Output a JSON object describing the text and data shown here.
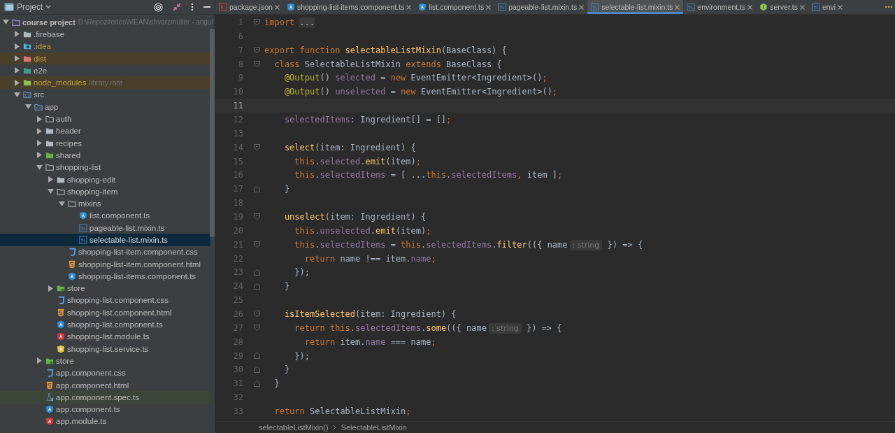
{
  "project_panel": {
    "title": "Project",
    "tree": [
      {
        "name": "course project",
        "path": "D:\\Repozitories\\MEAN\\shvarzmuller - angul",
        "kind": "root-folder",
        "expanded": true,
        "selected": false,
        "children": [
          {
            "name": ".firebase",
            "kind": "folder",
            "expanded": false,
            "selected": false,
            "ignored": false,
            "excluded": false
          },
          {
            "name": ".idea",
            "kind": "idea-folder",
            "expanded": false,
            "selected": false,
            "ignored": true,
            "excluded": false
          },
          {
            "name": "dist",
            "kind": "excluded-folder",
            "expanded": false,
            "selected": false,
            "ignored": true,
            "excluded": true
          },
          {
            "name": "e2e",
            "kind": "test-folder",
            "expanded": false,
            "selected": false,
            "ignored": false,
            "excluded": false
          },
          {
            "name": "node_modules",
            "suffix": "library root",
            "kind": "library-folder",
            "expanded": false,
            "selected": false,
            "ignored": true,
            "excluded": true
          },
          {
            "name": "src",
            "kind": "source-folder",
            "expanded": true,
            "selected": false,
            "ignored": false,
            "excluded": false,
            "children": [
              {
                "name": "app",
                "kind": "source-folder",
                "expanded": true,
                "selected": false,
                "children": [
                  {
                    "name": "auth",
                    "kind": "folder-outline",
                    "expanded": false,
                    "selected": false
                  },
                  {
                    "name": "header",
                    "kind": "folder",
                    "expanded": false,
                    "selected": false
                  },
                  {
                    "name": "recipes",
                    "kind": "folder",
                    "expanded": false,
                    "selected": false
                  },
                  {
                    "name": "shared",
                    "kind": "module-folder",
                    "expanded": false,
                    "selected": false
                  },
                  {
                    "name": "shopping-list",
                    "kind": "folder-outline",
                    "expanded": true,
                    "selected": false,
                    "children": [
                      {
                        "name": "shopping-edit",
                        "kind": "folder",
                        "expanded": false,
                        "selected": false
                      },
                      {
                        "name": "shopping-item",
                        "kind": "folder-outline",
                        "expanded": true,
                        "selected": false,
                        "children": [
                          {
                            "name": "mixins",
                            "kind": "folder-outline",
                            "expanded": true,
                            "selected": false,
                            "children": [
                              {
                                "name": "list.component.ts",
                                "kind": "angular-component",
                                "selected": false
                              },
                              {
                                "name": "pageable-list.mixin.ts",
                                "kind": "typescript",
                                "selected": false
                              },
                              {
                                "name": "selectable-list.mixin.ts",
                                "kind": "typescript",
                                "selected": true
                              }
                            ]
                          },
                          {
                            "name": "shopping-list-item.component.css",
                            "kind": "css",
                            "selected": false
                          },
                          {
                            "name": "shopping-list-item.component.html",
                            "kind": "html",
                            "selected": false
                          },
                          {
                            "name": "shopping-list-items.component.ts",
                            "kind": "angular-component",
                            "selected": false
                          }
                        ]
                      },
                      {
                        "name": "store",
                        "kind": "store-folder",
                        "expanded": false,
                        "selected": false
                      },
                      {
                        "name": "shopping-list.component.css",
                        "kind": "css",
                        "selected": false
                      },
                      {
                        "name": "shopping-list.component.html",
                        "kind": "html",
                        "selected": false
                      },
                      {
                        "name": "shopping-list.component.ts",
                        "kind": "angular-component",
                        "selected": false
                      },
                      {
                        "name": "shopping-list.module.ts",
                        "kind": "angular-module",
                        "selected": false
                      },
                      {
                        "name": "shopping-list.service.ts",
                        "kind": "angular-service",
                        "selected": false
                      }
                    ]
                  },
                  {
                    "name": "store",
                    "kind": "store-folder",
                    "expanded": false,
                    "selected": false
                  },
                  {
                    "name": "app.component.css",
                    "kind": "css",
                    "selected": false
                  },
                  {
                    "name": "app.component.html",
                    "kind": "html",
                    "selected": false
                  },
                  {
                    "name": "app.component.spec.ts",
                    "kind": "spec",
                    "selected": false
                  },
                  {
                    "name": "app.component.ts",
                    "kind": "angular-component",
                    "selected": false
                  },
                  {
                    "name": "app.module.ts",
                    "kind": "angular-module",
                    "selected": false
                  }
                ]
              }
            ]
          }
        ]
      }
    ]
  },
  "tabs": [
    {
      "label": "package.json",
      "kind": "json",
      "selected": false
    },
    {
      "label": "shopping-list-items.component.ts",
      "kind": "angular-component",
      "selected": false
    },
    {
      "label": "list.component.ts",
      "kind": "angular-component",
      "selected": false
    },
    {
      "label": "pageable-list.mixin.ts",
      "kind": "typescript",
      "selected": false
    },
    {
      "label": "selectable-list.mixin.ts",
      "kind": "typescript",
      "selected": true
    },
    {
      "label": "environment.ts",
      "kind": "typescript",
      "selected": false
    },
    {
      "label": "server.ts",
      "kind": "node",
      "selected": false
    },
    {
      "label": "envi",
      "kind": "typescript",
      "selected": false
    }
  ],
  "editor": {
    "lines": [
      {
        "number": "1",
        "kind": "fold-start",
        "current": false,
        "tokens": [
          {
            "kind": "keyword",
            "text": "import"
          },
          {
            "kind": "folded",
            "text": "..."
          }
        ]
      },
      {
        "number": "6",
        "kind": "plain",
        "current": false
      },
      {
        "number": "7",
        "kind": "fold-start",
        "current": false,
        "tokens": [
          {
            "kind": "keyword",
            "text": "export function "
          },
          {
            "kind": "function",
            "text": "selectableListMixin"
          },
          {
            "kind": "plain",
            "text": "(BaseClass) {"
          }
        ]
      },
      {
        "number": "8",
        "kind": "fold-start",
        "current": false,
        "tokens": [
          {
            "kind": "keyword",
            "text": "  class "
          },
          {
            "kind": "plain",
            "text": "SelectableListMixin "
          },
          {
            "kind": "keyword",
            "text": "extends "
          },
          {
            "kind": "plain",
            "text": "BaseClass {"
          }
        ]
      },
      {
        "number": "9",
        "kind": "plain",
        "current": false,
        "tokens": [
          {
            "kind": "decorator",
            "text": "    @Output"
          },
          {
            "kind": "plain",
            "text": "() "
          },
          {
            "kind": "field",
            "text": "selected"
          },
          {
            "kind": "plain",
            "text": " = "
          },
          {
            "kind": "keyword",
            "text": "new "
          },
          {
            "kind": "plain",
            "text": "EventEmitter<Ingredient>()"
          },
          {
            "kind": "keyword",
            "text": ";"
          }
        ]
      },
      {
        "number": "10",
        "kind": "plain",
        "current": false,
        "tokens": [
          {
            "kind": "decorator",
            "text": "    @Output"
          },
          {
            "kind": "plain",
            "text": "() "
          },
          {
            "kind": "field",
            "text": "unselected"
          },
          {
            "kind": "plain",
            "text": " = "
          },
          {
            "kind": "keyword",
            "text": "new "
          },
          {
            "kind": "plain",
            "text": "EventEmitter<Ingredient>()"
          },
          {
            "kind": "keyword",
            "text": ";"
          }
        ]
      },
      {
        "number": "11",
        "kind": "plain",
        "current": true
      },
      {
        "number": "12",
        "kind": "plain",
        "current": false,
        "tokens": [
          {
            "kind": "field",
            "text": "    selectedItems"
          },
          {
            "kind": "plain",
            "text": ": Ingredient[] = []"
          },
          {
            "kind": "keyword",
            "text": ";"
          }
        ]
      },
      {
        "number": "13",
        "kind": "plain",
        "current": false
      },
      {
        "number": "14",
        "kind": "fold-start",
        "current": false,
        "tokens": [
          {
            "kind": "function",
            "text": "    select"
          },
          {
            "kind": "plain",
            "text": "(item: Ingredient) {"
          }
        ]
      },
      {
        "number": "15",
        "kind": "plain",
        "current": false,
        "tokens": [
          {
            "kind": "keyword",
            "text": "      this"
          },
          {
            "kind": "plain",
            "text": "."
          },
          {
            "kind": "field",
            "text": "selected"
          },
          {
            "kind": "plain",
            "text": "."
          },
          {
            "kind": "function",
            "text": "emit"
          },
          {
            "kind": "plain",
            "text": "(item)"
          },
          {
            "kind": "keyword",
            "text": ";"
          }
        ]
      },
      {
        "number": "16",
        "kind": "plain",
        "current": false,
        "tokens": [
          {
            "kind": "keyword",
            "text": "      this"
          },
          {
            "kind": "plain",
            "text": "."
          },
          {
            "kind": "field",
            "text": "selectedItems"
          },
          {
            "kind": "plain",
            "text": " = [ ..."
          },
          {
            "kind": "keyword",
            "text": "this"
          },
          {
            "kind": "plain",
            "text": "."
          },
          {
            "kind": "field",
            "text": "selectedItems"
          },
          {
            "kind": "keyword",
            "text": ","
          },
          {
            "kind": "plain",
            "text": " item ]"
          },
          {
            "kind": "keyword",
            "text": ";"
          }
        ]
      },
      {
        "number": "17",
        "kind": "fold-end",
        "current": false,
        "tokens": [
          {
            "kind": "plain",
            "text": "    }"
          }
        ]
      },
      {
        "number": "18",
        "kind": "plain",
        "current": false
      },
      {
        "number": "19",
        "kind": "fold-start",
        "current": false,
        "tokens": [
          {
            "kind": "function",
            "text": "    unselect"
          },
          {
            "kind": "plain",
            "text": "(item: Ingredient) {"
          }
        ]
      },
      {
        "number": "20",
        "kind": "plain",
        "current": false,
        "tokens": [
          {
            "kind": "keyword",
            "text": "      this"
          },
          {
            "kind": "plain",
            "text": "."
          },
          {
            "kind": "field",
            "text": "unselected"
          },
          {
            "kind": "plain",
            "text": "."
          },
          {
            "kind": "function",
            "text": "emit"
          },
          {
            "kind": "plain",
            "text": "(item)"
          },
          {
            "kind": "keyword",
            "text": ";"
          }
        ]
      },
      {
        "number": "21",
        "kind": "fold-start",
        "current": false,
        "tokens": [
          {
            "kind": "keyword",
            "text": "      this"
          },
          {
            "kind": "plain",
            "text": "."
          },
          {
            "kind": "field",
            "text": "selectedItems"
          },
          {
            "kind": "plain",
            "text": " = "
          },
          {
            "kind": "keyword",
            "text": "this"
          },
          {
            "kind": "plain",
            "text": "."
          },
          {
            "kind": "field",
            "text": "selectedItems"
          },
          {
            "kind": "plain",
            "text": "."
          },
          {
            "kind": "function",
            "text": "filter"
          },
          {
            "kind": "plain",
            "text": "(({ name"
          },
          {
            "kind": "hint",
            "text": ": string"
          },
          {
            "kind": "plain",
            "text": " }) => {"
          }
        ]
      },
      {
        "number": "22",
        "kind": "plain",
        "current": false,
        "tokens": [
          {
            "kind": "keyword",
            "text": "        return "
          },
          {
            "kind": "plain",
            "text": "name !== item."
          },
          {
            "kind": "field",
            "text": "name"
          },
          {
            "kind": "keyword",
            "text": ";"
          }
        ]
      },
      {
        "number": "23",
        "kind": "fold-end",
        "current": false,
        "tokens": [
          {
            "kind": "plain",
            "text": "      });"
          }
        ]
      },
      {
        "number": "24",
        "kind": "fold-end",
        "current": false,
        "tokens": [
          {
            "kind": "plain",
            "text": "    }"
          }
        ]
      },
      {
        "number": "25",
        "kind": "plain",
        "current": false
      },
      {
        "number": "26",
        "kind": "fold-start",
        "current": false,
        "tokens": [
          {
            "kind": "function",
            "text": "    isItemSelected"
          },
          {
            "kind": "plain",
            "text": "(item: Ingredient) {"
          }
        ]
      },
      {
        "number": "27",
        "kind": "fold-start",
        "current": false,
        "tokens": [
          {
            "kind": "keyword",
            "text": "      return this"
          },
          {
            "kind": "plain",
            "text": "."
          },
          {
            "kind": "field",
            "text": "selectedItems"
          },
          {
            "kind": "plain",
            "text": "."
          },
          {
            "kind": "function",
            "text": "some"
          },
          {
            "kind": "plain",
            "text": "(({ name"
          },
          {
            "kind": "hint",
            "text": ": string"
          },
          {
            "kind": "plain",
            "text": " }) => {"
          }
        ]
      },
      {
        "number": "28",
        "kind": "plain",
        "current": false,
        "tokens": [
          {
            "kind": "keyword",
            "text": "        return "
          },
          {
            "kind": "plain",
            "text": "item."
          },
          {
            "kind": "field",
            "text": "name"
          },
          {
            "kind": "plain",
            "text": " === name"
          },
          {
            "kind": "keyword",
            "text": ";"
          }
        ]
      },
      {
        "number": "29",
        "kind": "fold-end",
        "current": false,
        "tokens": [
          {
            "kind": "plain",
            "text": "      });"
          }
        ]
      },
      {
        "number": "30",
        "kind": "fold-end",
        "current": false,
        "tokens": [
          {
            "kind": "plain",
            "text": "    }"
          }
        ]
      },
      {
        "number": "31",
        "kind": "fold-end",
        "current": false,
        "tokens": [
          {
            "kind": "plain",
            "text": "  }"
          }
        ]
      },
      {
        "number": "32",
        "kind": "plain",
        "current": false
      },
      {
        "number": "33",
        "kind": "plain",
        "current": false,
        "tokens": [
          {
            "kind": "keyword",
            "text": "  return "
          },
          {
            "kind": "plain",
            "text": "SelectableListMixin"
          },
          {
            "kind": "keyword",
            "text": ";"
          }
        ]
      }
    ]
  },
  "breadcrumbs": [
    "selectableListMixin()",
    "SelectableListMixin"
  ]
}
